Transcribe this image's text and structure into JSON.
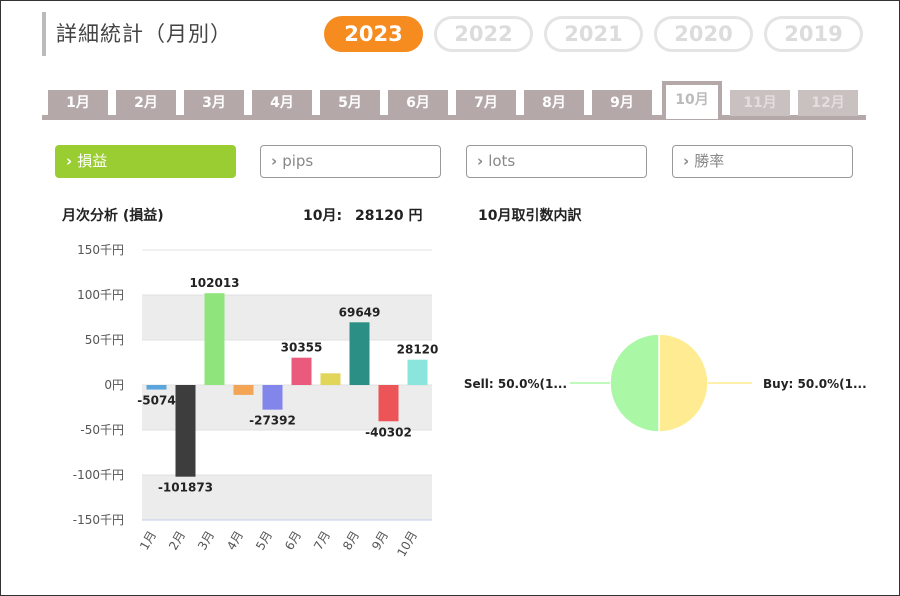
{
  "header": {
    "title": "詳細統計（月別）"
  },
  "years": {
    "items": [
      "2023",
      "2022",
      "2021",
      "2020",
      "2019"
    ],
    "active_index": 0
  },
  "months": {
    "items": [
      "1月",
      "2月",
      "3月",
      "4月",
      "5月",
      "6月",
      "7月",
      "8月",
      "9月",
      "10月",
      "11月",
      "12月"
    ],
    "active_index": 9,
    "available_count": 10
  },
  "metrics": {
    "items": [
      "損益",
      "pips",
      "lots",
      "勝率"
    ],
    "active_index": 0,
    "chevron": "›"
  },
  "monthly": {
    "title": "月次分析 (損益)",
    "summary_label": "10月:",
    "summary_value": "28120 円"
  },
  "breakdown": {
    "title": "10月取引数内訳"
  },
  "colors": {
    "accent": "#f68b1f",
    "active_metric": "#9acd32",
    "tab": "#b5a8a8"
  },
  "chart_data": [
    {
      "type": "bar",
      "categories": [
        "1月",
        "2月",
        "3月",
        "4月",
        "5月",
        "6月",
        "7月",
        "8月",
        "9月",
        "10月"
      ],
      "values": [
        -5074,
        -101873,
        102013,
        -11000,
        -27392,
        30355,
        13000,
        69649,
        -40302,
        28120
      ],
      "data_labels": [
        "-5074",
        "-101873",
        "102013",
        "",
        "-27392",
        "30355",
        "",
        "69649",
        "-40302",
        "28120"
      ],
      "bar_colors": [
        "#5aa6dc",
        "#3d3d3d",
        "#8fe57b",
        "#f3a455",
        "#8285ea",
        "#ea5a7d",
        "#e2d65a",
        "#2b8f86",
        "#ec5458",
        "#8ae6dd"
      ],
      "yticks": [
        150000,
        100000,
        50000,
        0,
        -50000,
        -100000,
        -150000
      ],
      "ytick_labels": [
        "150千円",
        "100千円",
        "50千円",
        "0円",
        "-50千円",
        "-100千円",
        "-150千円"
      ],
      "ylim": [
        -150000,
        150000
      ],
      "grid": true
    },
    {
      "type": "pie",
      "labels": [
        "Sell: 50.0%(1...",
        "Buy: 50.0%(1..."
      ],
      "values": [
        50,
        50
      ],
      "colors": [
        "#aaf7a6",
        "#ffeb91"
      ]
    }
  ]
}
